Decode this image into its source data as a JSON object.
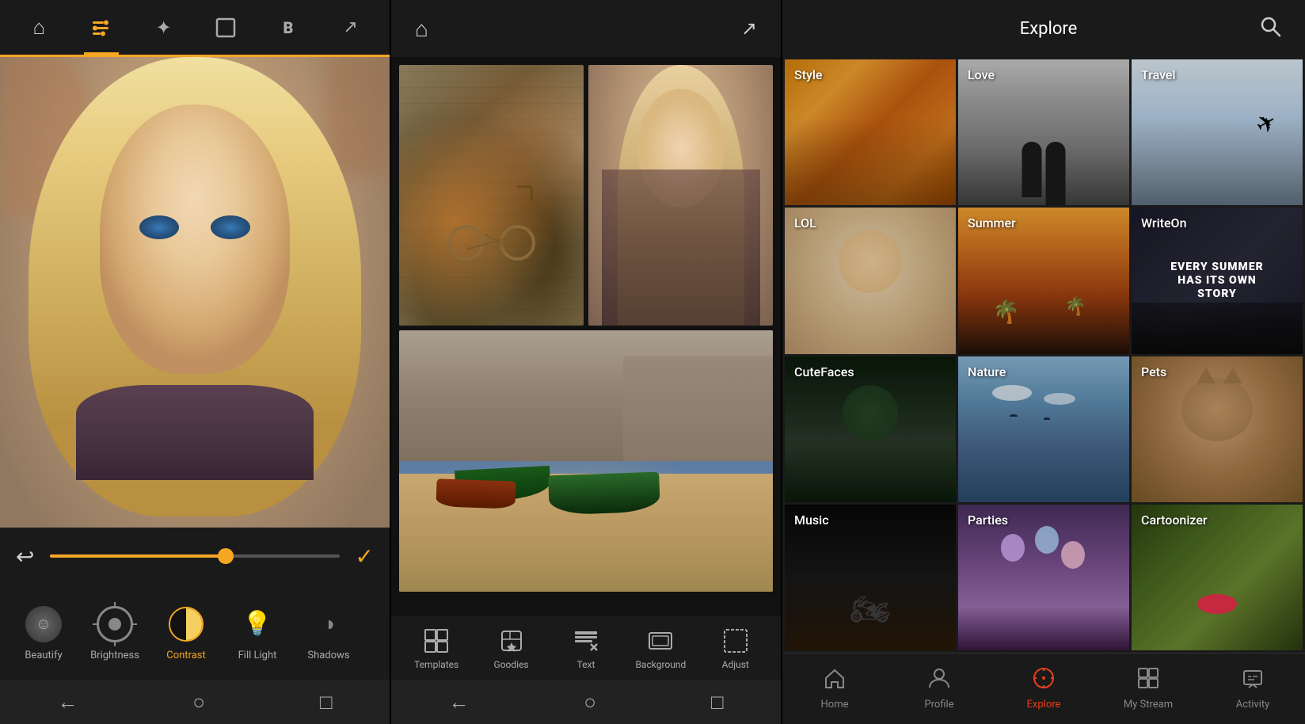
{
  "panel_editor": {
    "toolbar": {
      "items": [
        {
          "id": "home",
          "icon": "⌂",
          "active": false
        },
        {
          "id": "tools",
          "icon": "⊞",
          "active": true
        },
        {
          "id": "wand",
          "icon": "✦",
          "active": false
        },
        {
          "id": "frame",
          "icon": "▭",
          "active": false
        },
        {
          "id": "bold",
          "icon": "B",
          "active": false
        },
        {
          "id": "share",
          "icon": "↗",
          "active": false
        }
      ]
    },
    "tools": [
      {
        "id": "beautify",
        "label": "Beautify",
        "active": false
      },
      {
        "id": "brightness",
        "label": "Brightness",
        "active": false
      },
      {
        "id": "contrast",
        "label": "Contrast",
        "active": true
      },
      {
        "id": "filllight",
        "label": "Fill Light",
        "active": false
      },
      {
        "id": "shadows",
        "label": "Shadows",
        "active": false
      }
    ],
    "nav": [
      "←",
      "○",
      "□"
    ]
  },
  "panel_collage": {
    "toolbar": {
      "share_icon": "↗",
      "home_icon": "⌂"
    },
    "bottom_tools": [
      {
        "id": "templates",
        "label": "Templates",
        "icon": "⊞"
      },
      {
        "id": "goodies",
        "label": "Goodies",
        "icon": "◈"
      },
      {
        "id": "text",
        "label": "Text",
        "icon": "T"
      },
      {
        "id": "background",
        "label": "Background",
        "icon": "▣"
      },
      {
        "id": "adjust",
        "label": "Adjust",
        "icon": "⊡"
      }
    ],
    "nav": [
      "←",
      "○",
      "□"
    ]
  },
  "panel_explore": {
    "header": {
      "title": "Explore",
      "search_icon": "🔍"
    },
    "grid": [
      {
        "id": "style",
        "label": "Style",
        "bg_class": "bg-style",
        "row": 1,
        "col": 1
      },
      {
        "id": "love",
        "label": "Love",
        "bg_class": "bg-love",
        "row": 1,
        "col": 2
      },
      {
        "id": "travel",
        "label": "Travel",
        "bg_class": "bg-travel",
        "row": 1,
        "col": 3
      },
      {
        "id": "lol",
        "label": "LOL",
        "bg_class": "bg-lol",
        "row": 2,
        "col": 1
      },
      {
        "id": "summer",
        "label": "Summer",
        "bg_class": "bg-summer",
        "row": 2,
        "col": 2
      },
      {
        "id": "writeon",
        "label": "WriteOn",
        "bg_class": "bg-writeon",
        "row": 2,
        "col": 3,
        "subtext": "EVERY SUMMER HAS ITS OWN STORY"
      },
      {
        "id": "cutefaces",
        "label": "CuteFaces",
        "bg_class": "bg-cutefaces",
        "row": 3,
        "col": 1
      },
      {
        "id": "nature",
        "label": "Nature",
        "bg_class": "bg-nature",
        "row": 3,
        "col": 2
      },
      {
        "id": "pets",
        "label": "Pets",
        "bg_class": "bg-pets",
        "row": 3,
        "col": 3
      },
      {
        "id": "music",
        "label": "Music",
        "bg_class": "bg-music",
        "row": 4,
        "col": 1
      },
      {
        "id": "parties",
        "label": "Parties",
        "bg_class": "bg-parties",
        "row": 4,
        "col": 2
      },
      {
        "id": "cartoonizer",
        "label": "Cartoonizer",
        "bg_class": "bg-cartoonizer",
        "row": 4,
        "col": 3
      }
    ],
    "bottom_nav": [
      {
        "id": "home",
        "label": "Home",
        "icon": "⌂",
        "active": false
      },
      {
        "id": "profile",
        "label": "Profile",
        "icon": "👤",
        "active": false
      },
      {
        "id": "explore",
        "label": "Explore",
        "icon": "🌐",
        "active": true
      },
      {
        "id": "mystream",
        "label": "My Stream",
        "icon": "⊞",
        "active": false
      },
      {
        "id": "activity",
        "label": "Activity",
        "icon": "💬",
        "active": false
      }
    ]
  }
}
